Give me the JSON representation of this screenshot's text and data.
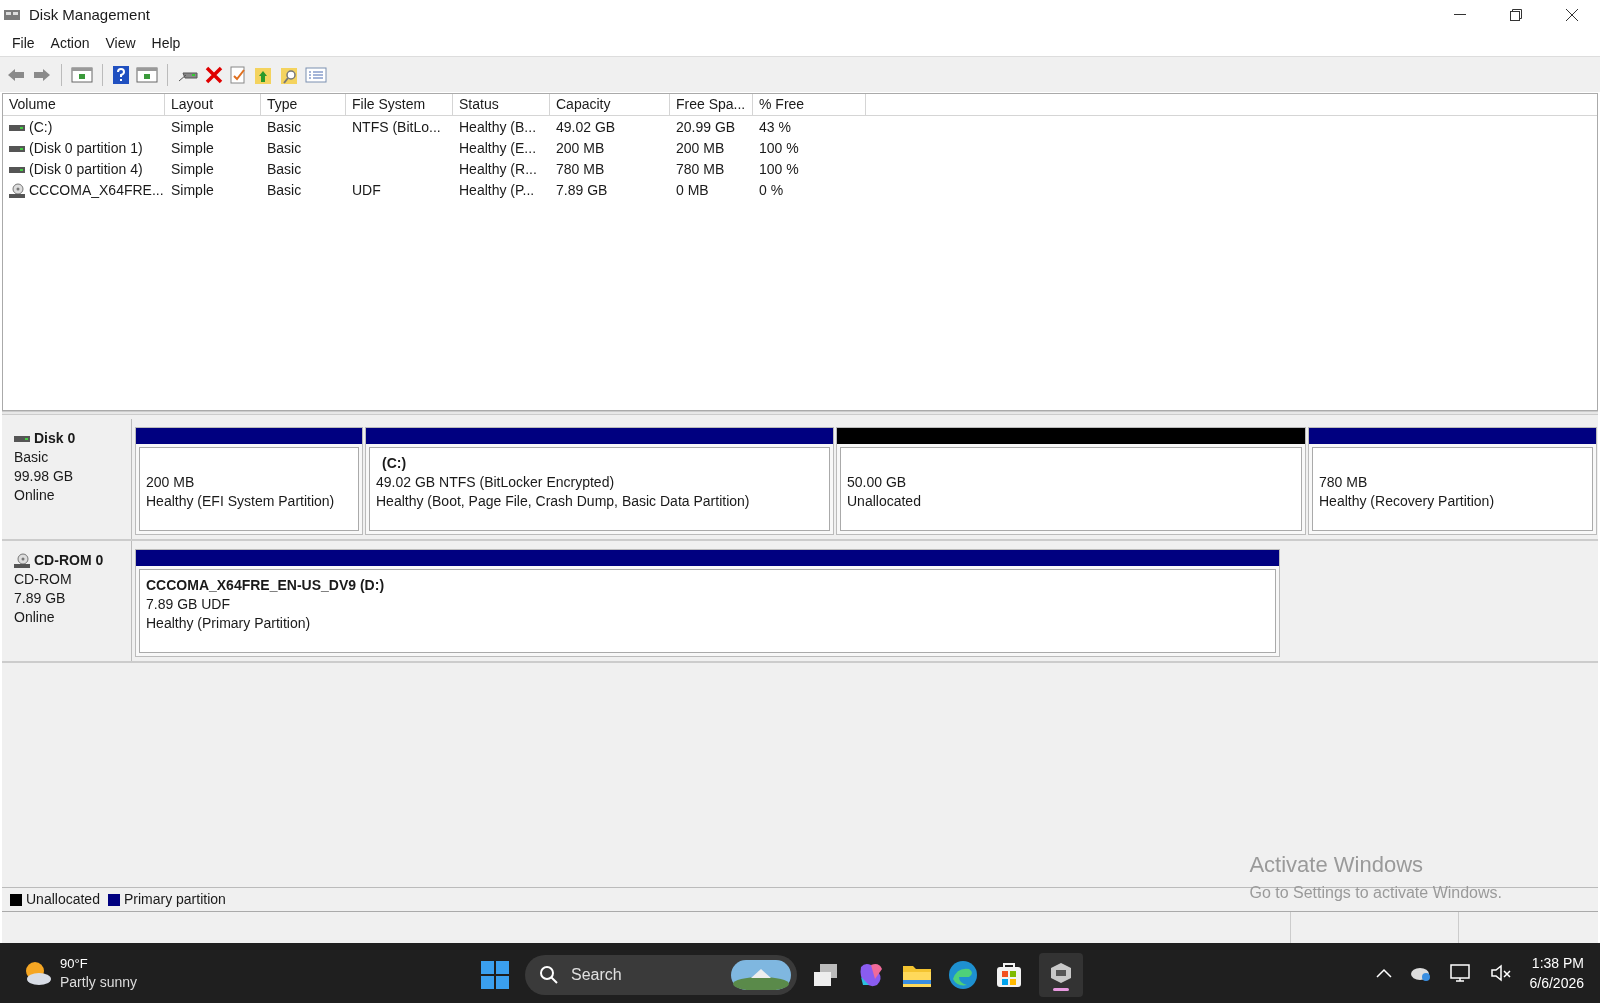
{
  "window": {
    "title": "Disk Management"
  },
  "menu": [
    "File",
    "Action",
    "View",
    "Help"
  ],
  "table": {
    "columns": [
      "Volume",
      "Layout",
      "Type",
      "File System",
      "Status",
      "Capacity",
      "Free Spa...",
      "% Free"
    ],
    "rows": [
      {
        "kind": "disk",
        "cells": [
          "(C:)",
          "Simple",
          "Basic",
          "NTFS (BitLo...",
          "Healthy (B...",
          "49.02 GB",
          "20.99 GB",
          "43 %"
        ]
      },
      {
        "kind": "disk",
        "cells": [
          "(Disk 0 partition 1)",
          "Simple",
          "Basic",
          "",
          "Healthy (E...",
          "200 MB",
          "200 MB",
          "100 %"
        ]
      },
      {
        "kind": "disk",
        "cells": [
          "(Disk 0 partition 4)",
          "Simple",
          "Basic",
          "",
          "Healthy (R...",
          "780 MB",
          "780 MB",
          "100 %"
        ]
      },
      {
        "kind": "cd",
        "cells": [
          "CCCOMA_X64FRE...",
          "Simple",
          "Basic",
          "UDF",
          "Healthy (P...",
          "7.89 GB",
          "0 MB",
          "0 %"
        ]
      }
    ]
  },
  "disks": [
    {
      "kind": "disk",
      "name": "Disk 0",
      "type": "Basic",
      "size": "99.98 GB",
      "status": "Online",
      "partitions": [
        {
          "kind": "primary",
          "size_line": "200 MB",
          "status_line": "Healthy (EFI System Partition)"
        },
        {
          "kind": "primary",
          "title": "(C:)",
          "size_line": "49.02 GB NTFS (BitLocker Encrypted)",
          "status_line": "Healthy (Boot, Page File, Crash Dump, Basic Data Partition)"
        },
        {
          "kind": "unallocated",
          "size_line": "50.00 GB",
          "status_line": "Unallocated"
        },
        {
          "kind": "primary",
          "size_line": "780 MB",
          "status_line": "Healthy (Recovery Partition)"
        }
      ]
    },
    {
      "kind": "cd",
      "name": "CD-ROM 0",
      "type": "CD-ROM",
      "size": "7.89 GB",
      "status": "Online",
      "partitions": [
        {
          "kind": "primary",
          "title": "CCCOMA_X64FRE_EN-US_DV9  (D:)",
          "size_line": "7.89 GB UDF",
          "status_line": "Healthy (Primary Partition)"
        }
      ]
    }
  ],
  "legend": [
    {
      "label": "Unallocated",
      "color": "#000000"
    },
    {
      "label": "Primary partition",
      "color": "#000080"
    }
  ],
  "activation": {
    "title": "Activate Windows",
    "subtitle": "Go to Settings to activate Windows."
  },
  "taskbar": {
    "temperature": "90°F",
    "weather": "Partly sunny",
    "search_placeholder": "Search",
    "time": "1:38 PM",
    "date": "6/6/2026"
  }
}
